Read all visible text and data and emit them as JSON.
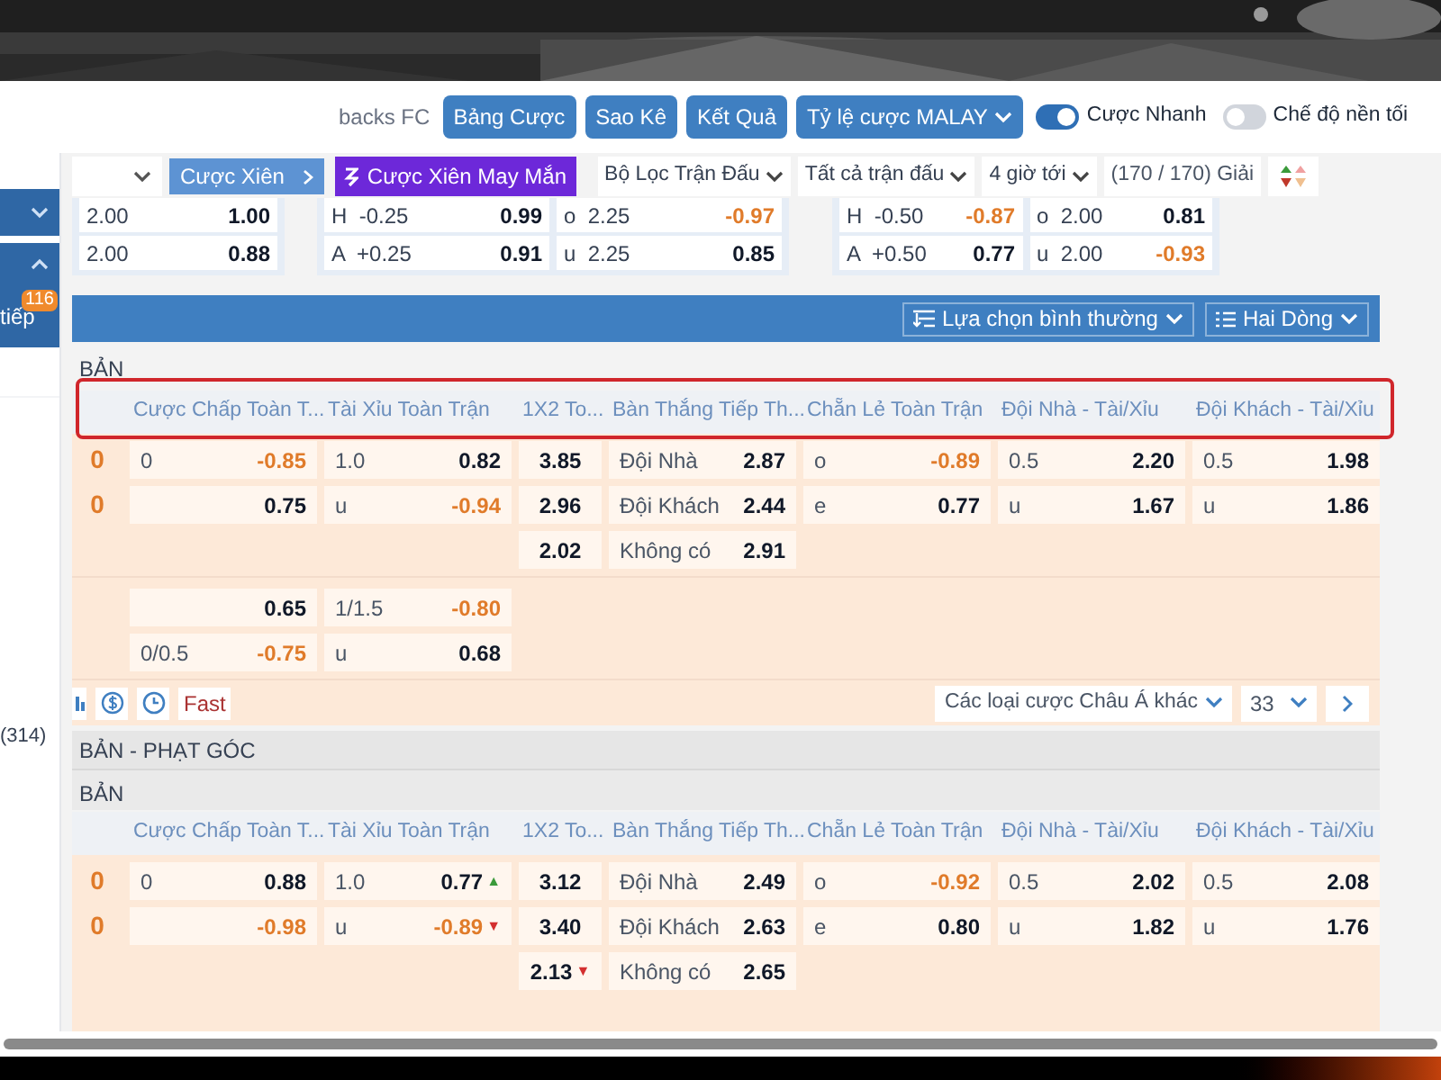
{
  "header": {
    "team": "backs FC",
    "buttons": [
      "Bảng Cược",
      "Sao Kê",
      "Kết Quả"
    ],
    "odds_format": "Tỷ lệ cược MALAY",
    "toggles": [
      {
        "label": "Cược Nhanh",
        "on": true
      },
      {
        "label": "Chế độ nền tối",
        "on": false
      }
    ]
  },
  "sidebar": {
    "badge": "116",
    "item_label": "tiếp",
    "count": "(314)"
  },
  "filters": {
    "parlay": "Cược Xiên",
    "lucky_parlay": "Cược Xiên May Mắn",
    "dropdowns": [
      "Bộ Lọc Trận Đấu",
      "Tất cả trận đấu",
      "4 giờ tới"
    ],
    "leagues": "(170 / 170) Giải"
  },
  "odds_cards": [
    {
      "rows": [
        [
          {
            "label": "2.00",
            "value": "1.00",
            "negative": false
          }
        ],
        [
          {
            "label": "2.00",
            "value": "0.88",
            "negative": false
          }
        ]
      ]
    },
    {
      "rows": [
        [
          {
            "label": "H  -0.25",
            "value": "0.99",
            "negative": false
          },
          {
            "label": "o  2.25",
            "value": "-0.97",
            "negative": true
          }
        ],
        [
          {
            "label": "A  +0.25",
            "value": "0.91",
            "negative": false
          },
          {
            "label": "u  2.25",
            "value": "0.85",
            "negative": false
          }
        ]
      ]
    },
    {
      "rows": [
        [
          {
            "label": "H  -0.50",
            "value": "-0.87",
            "negative": true
          },
          {
            "label": "o  2.00",
            "value": "0.81",
            "negative": false
          }
        ],
        [
          {
            "label": "A  +0.50",
            "value": "0.77",
            "negative": false
          },
          {
            "label": "u  2.00",
            "value": "-0.93",
            "negative": true
          }
        ]
      ]
    }
  ],
  "toolbar": {
    "selection": "Lựa chọn bình thường",
    "lines": "Hai Dòng"
  },
  "sections": [
    {
      "subtitle": "BẢN",
      "highlighted": true,
      "columns": [
        "Cược Chấp Toàn T...",
        "Tài Xỉu Toàn Trận",
        "1X2 To...",
        "Bàn Thắng Tiếp Th...",
        "Chẵn Lẻ Toàn Trận",
        "Đội Nhà - Tài/Xỉu",
        "Đội Khách - Tài/Xỉu"
      ],
      "groups": [
        {
          "lines": [
            {
              "score": "0",
              "cells": [
                {
                  "label": "0",
                  "value": "-0.85",
                  "negative": true
                },
                {
                  "label": "1.0",
                  "value": "0.82",
                  "negative": false
                },
                {
                  "value": "3.85",
                  "negative": false
                },
                {
                  "label": "Đội Nhà",
                  "value": "2.87",
                  "negative": false
                },
                {
                  "label": "o",
                  "value": "-0.89",
                  "negative": true
                },
                {
                  "label": "0.5",
                  "value": "2.20",
                  "negative": false
                },
                {
                  "label": "0.5",
                  "value": "1.98",
                  "negative": false
                }
              ]
            },
            {
              "score": "0",
              "cells": [
                {
                  "value": "0.75",
                  "negative": false
                },
                {
                  "label": "u",
                  "value": "-0.94",
                  "negative": true
                },
                {
                  "value": "2.96",
                  "negative": false
                },
                {
                  "label": "Đội Khách",
                  "value": "2.44",
                  "negative": false
                },
                {
                  "label": "e",
                  "value": "0.77",
                  "negative": false
                },
                {
                  "label": "u",
                  "value": "1.67",
                  "negative": false
                },
                {
                  "label": "u",
                  "value": "1.86",
                  "negative": false
                }
              ]
            },
            {
              "cells": [
                null,
                null,
                {
                  "value": "2.02",
                  "negative": false
                },
                {
                  "label": "Không có",
                  "value": "2.91",
                  "negative": false
                },
                null,
                null,
                null
              ]
            }
          ]
        },
        {
          "lines": [
            {
              "cells": [
                {
                  "value": "0.65",
                  "negative": false
                },
                {
                  "label": "1/1.5",
                  "value": "-0.80",
                  "negative": true
                },
                null,
                null,
                null,
                null,
                null
              ]
            },
            {
              "cells": [
                {
                  "label": "0/0.5",
                  "value": "-0.75",
                  "negative": true
                },
                {
                  "label": "u",
                  "value": "0.68",
                  "negative": false
                },
                null,
                null,
                null,
                null,
                null
              ]
            }
          ]
        }
      ],
      "footer": {
        "fast": "Fast",
        "market": "Các loại cược Châu Á khác",
        "count": "33"
      }
    },
    {
      "title": "BẢN - PHẠT GÓC",
      "subtitle": "BẢN",
      "highlighted": false,
      "columns": [
        "Cược Chấp Toàn T...",
        "Tài Xỉu Toàn Trận",
        "1X2 To...",
        "Bàn Thắng Tiếp Th...",
        "Chẵn Lẻ Toàn Trận",
        "Đội Nhà - Tài/Xỉu",
        "Đội Khách - Tài/Xỉu"
      ],
      "groups": [
        {
          "lines": [
            {
              "score": "0",
              "cells": [
                {
                  "label": "0",
                  "value": "0.88",
                  "negative": false
                },
                {
                  "label": "1.0",
                  "value": "0.77",
                  "negative": false,
                  "marker": {
                    "text": "▲",
                    "color": "#3a9a3a"
                  }
                },
                {
                  "value": "3.12",
                  "negative": false
                },
                {
                  "label": "Đội Nhà",
                  "value": "2.49",
                  "negative": false
                },
                {
                  "label": "o",
                  "value": "-0.92",
                  "negative": true
                },
                {
                  "label": "0.5",
                  "value": "2.02",
                  "negative": false
                },
                {
                  "label": "0.5",
                  "value": "2.08",
                  "negative": false
                }
              ]
            },
            {
              "score": "0",
              "cells": [
                {
                  "value": "-0.98",
                  "negative": true
                },
                {
                  "label": "u",
                  "value": "-0.89",
                  "negative": true,
                  "marker": {
                    "text": "▼",
                    "color": "#d32f2f"
                  }
                },
                {
                  "value": "3.40",
                  "negative": false
                },
                {
                  "label": "Đội Khách",
                  "value": "2.63",
                  "negative": false
                },
                {
                  "label": "e",
                  "value": "0.80",
                  "negative": false
                },
                {
                  "label": "u",
                  "value": "1.82",
                  "negative": false
                },
                {
                  "label": "u",
                  "value": "1.76",
                  "negative": false
                }
              ]
            },
            {
              "cells": [
                null,
                null,
                {
                  "value": "2.13",
                  "negative": false,
                  "marker": {
                    "text": "▼",
                    "color": "#d32f2f"
                  }
                },
                {
                  "label": "Không có",
                  "value": "2.65",
                  "negative": false
                },
                null,
                null,
                null
              ]
            }
          ]
        }
      ]
    }
  ]
}
